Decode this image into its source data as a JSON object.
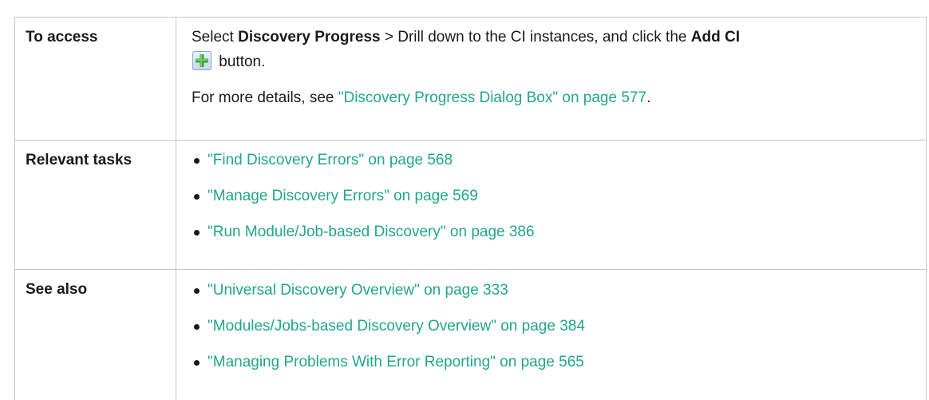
{
  "rows": {
    "access": {
      "label": "To access",
      "p1_pre": "Select ",
      "p1_bold1": "Discovery Progress",
      "p1_mid": " > Drill down to the CI instances, and click the ",
      "p1_bold2": "Add CI",
      "p1_icon": "add-plus-icon",
      "p1_post": " button.",
      "p2_pre": "For more details, see ",
      "p2_link": "\"Discovery Progress Dialog Box\" on page 577",
      "p2_post": "."
    },
    "tasks": {
      "label": "Relevant tasks",
      "items": [
        "\"Find Discovery Errors\" on page 568",
        "\"Manage Discovery Errors\" on page 569",
        "\"Run Module/Job-based Discovery\" on page 386"
      ]
    },
    "see_also": {
      "label": "See also",
      "items": [
        "\"Universal Discovery Overview\" on page 333",
        "\"Modules/Jobs-based Discovery Overview\" on page 384",
        "\"Managing Problems With Error Reporting\" on page 565"
      ]
    }
  },
  "colors": {
    "link": "#21a68d",
    "border": "#c7c7c7",
    "text": "#1a1a1a"
  }
}
